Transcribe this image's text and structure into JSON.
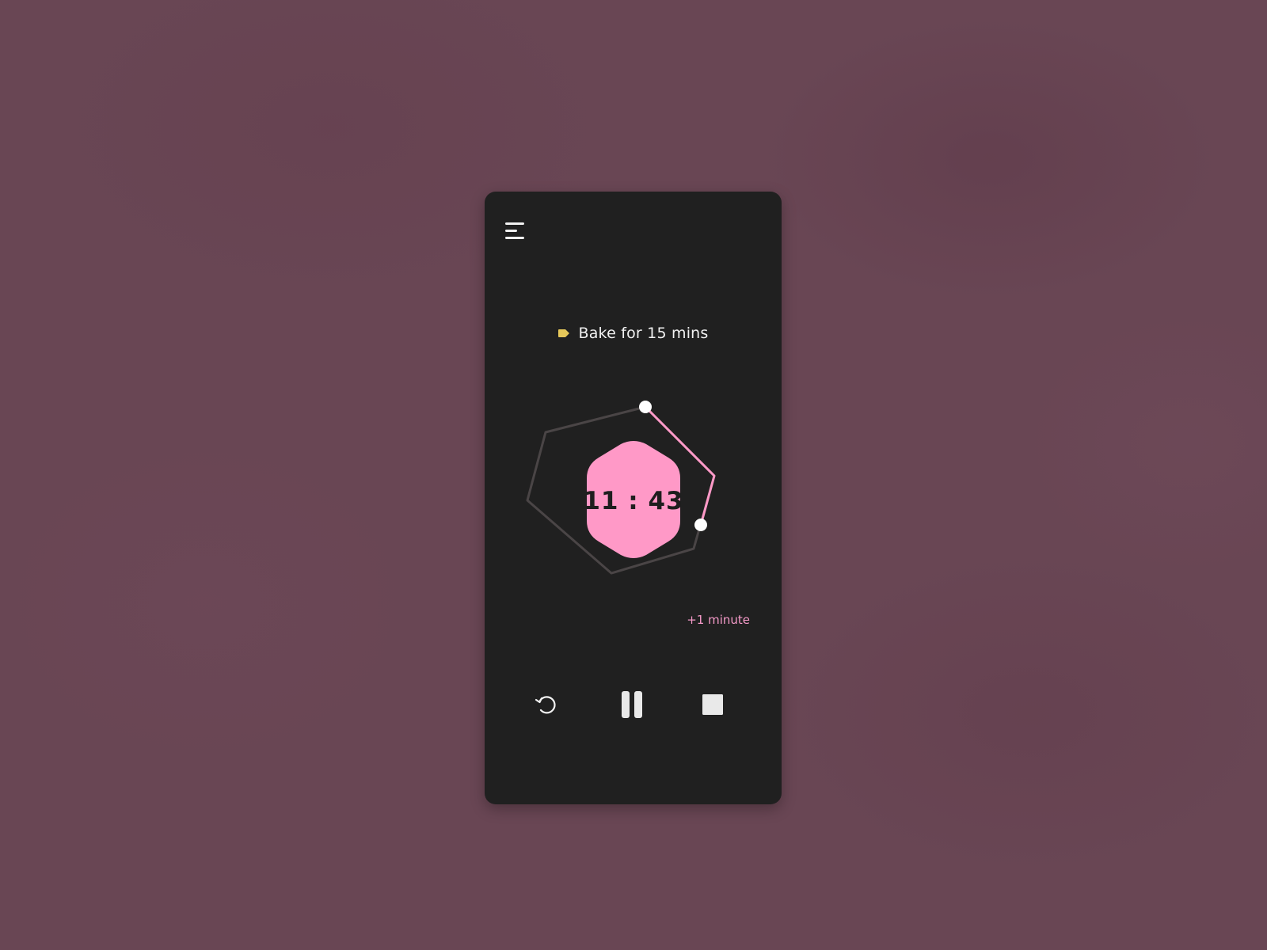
{
  "task": {
    "label": "Bake for 15 mins",
    "tag_color": "#e6c85a"
  },
  "timer": {
    "display": "11 : 43",
    "accent_color": "#ff99c7",
    "add_time_label": "+1 minute",
    "icons": {
      "start_handle": "handle-dot",
      "end_handle": "handle-dot"
    }
  },
  "controls": {
    "icons": [
      "restart-icon",
      "pause-icon",
      "stop-icon"
    ]
  },
  "theme": {
    "background": "#694654",
    "card": "#202020",
    "track": "#4a4546",
    "foreground": "#f1f1f1"
  }
}
